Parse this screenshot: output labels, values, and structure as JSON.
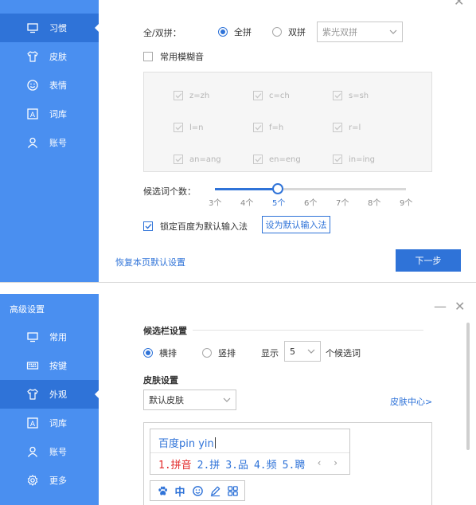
{
  "panel1": {
    "sidebar": {
      "items": [
        {
          "label": "习惯",
          "icon": "monitor-icon",
          "active": true
        },
        {
          "label": "皮肤",
          "icon": "tshirt-icon"
        },
        {
          "label": "表情",
          "icon": "smiley-icon"
        },
        {
          "label": "词库",
          "icon": "dictionary-icon"
        },
        {
          "label": "账号",
          "icon": "person-icon"
        }
      ]
    },
    "pinyin_mode": {
      "label": "全/双拼：",
      "options": [
        "全拼",
        "双拼"
      ],
      "selected": "全拼",
      "scheme_select_value": "紫光双拼"
    },
    "fuzzy": {
      "label": "常用模糊音",
      "checked": false,
      "items": [
        "z=zh",
        "c=ch",
        "s=sh",
        "l=n",
        "f=h",
        "r=l",
        "an=ang",
        "en=eng",
        "in=ing"
      ]
    },
    "candidates": {
      "label": "候选词个数：",
      "ticks": [
        "3个",
        "4个",
        "5个",
        "6个",
        "7个",
        "8个",
        "9个"
      ],
      "value": "5个"
    },
    "default_ime": {
      "label": "锁定百度为默认输入法",
      "checked": true,
      "button": "设为默认输入法"
    },
    "footer": {
      "restore_link": "恢复本页默认设置",
      "next_button": "下一步"
    }
  },
  "panel2": {
    "window_title": "高级设置",
    "sidebar": {
      "items": [
        {
          "label": "常用",
          "icon": "monitor-icon"
        },
        {
          "label": "按键",
          "icon": "keyboard-icon"
        },
        {
          "label": "外观",
          "icon": "tshirt-icon",
          "active": true
        },
        {
          "label": "词库",
          "icon": "dictionary-icon"
        },
        {
          "label": "账号",
          "icon": "person-icon"
        },
        {
          "label": "更多",
          "icon": "gear-icon"
        }
      ]
    },
    "candidate_bar": {
      "title": "候选栏设置",
      "orientation_options": [
        "横排",
        "竖排"
      ],
      "selected": "横排",
      "show_label": "显示",
      "count_value": "5",
      "count_suffix": "个候选词"
    },
    "skin": {
      "title": "皮肤设置",
      "select_value": "默认皮肤",
      "center_link": "皮肤中心>"
    },
    "preview": {
      "composition": "百度pin yin",
      "candidates": [
        "1.拼音",
        "2.拼",
        "3.品",
        "4.频",
        "5.聘"
      ],
      "arrows": "‹ ›",
      "toolbar": [
        {
          "icon": "paw-icon"
        },
        {
          "icon": "chinese-mode-icon",
          "text": "中"
        },
        {
          "icon": "smiley-icon"
        },
        {
          "icon": "pen-icon"
        },
        {
          "icon": "grid-icon"
        }
      ]
    }
  },
  "colors": {
    "sidebar": "#4a8ff0",
    "sidebar_active": "#2f73d8",
    "accent": "#2f73d8",
    "highlight_candidate": "#e22a2a"
  }
}
